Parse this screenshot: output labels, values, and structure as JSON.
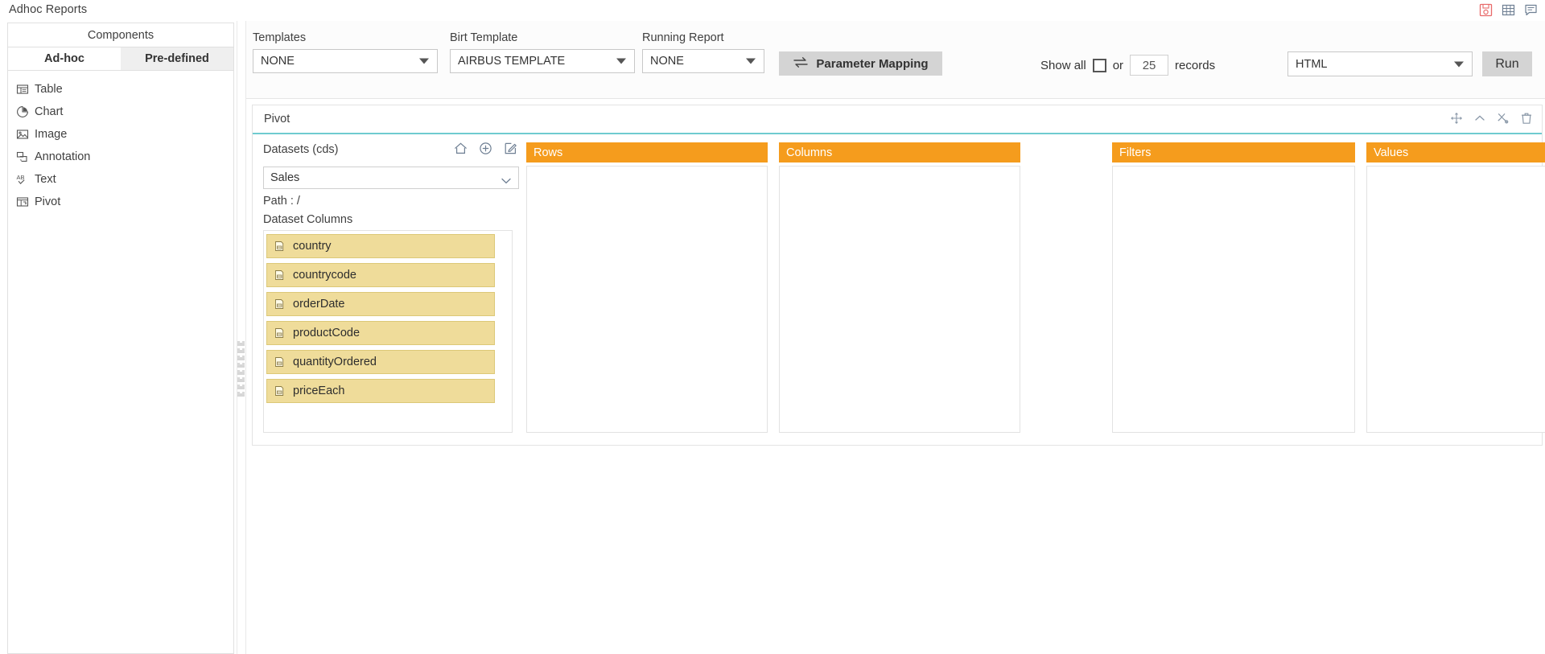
{
  "titlebar": {
    "app_title": "Adhoc Reports",
    "icons": [
      {
        "name": "save-report-icon",
        "label": "Save"
      },
      {
        "name": "grid-icon",
        "label": "Grid"
      },
      {
        "name": "comment-icon",
        "label": "Comment"
      }
    ]
  },
  "sidebar": {
    "header": "Components",
    "tabs": [
      {
        "label": "Ad-hoc",
        "active": true
      },
      {
        "label": "Pre-defined",
        "active": false
      }
    ],
    "items": [
      {
        "label": "Table",
        "icon": "table-icon"
      },
      {
        "label": "Chart",
        "icon": "pie-chart-icon"
      },
      {
        "label": "Image",
        "icon": "image-icon"
      },
      {
        "label": "Annotation",
        "icon": "annotation-icon"
      },
      {
        "label": "Text",
        "icon": "text-ab-icon"
      },
      {
        "label": "Pivot",
        "icon": "pivot-icon"
      }
    ]
  },
  "toolbar": {
    "templates": {
      "label": "Templates",
      "value": "NONE"
    },
    "birt_template": {
      "label": "Birt Template",
      "value": "AIRBUS TEMPLATE"
    },
    "running_report": {
      "label": "Running Report",
      "value": "NONE"
    },
    "parameter_mapping_label": "Parameter Mapping",
    "show_all_label": "Show all",
    "or_label": "or",
    "records_value": "25",
    "records_label": "records",
    "format": {
      "value": "HTML"
    },
    "run_label": "Run"
  },
  "pivot": {
    "title": "Pivot",
    "panel_icons": [
      {
        "name": "move-icon"
      },
      {
        "name": "collapse-chevron-up-icon"
      },
      {
        "name": "tools-icon"
      },
      {
        "name": "delete-trash-icon"
      }
    ],
    "datasets": {
      "label": "Datasets (cds)",
      "icons": [
        {
          "name": "home-icon"
        },
        {
          "name": "add-circle-icon"
        },
        {
          "name": "edit-icon"
        }
      ],
      "selected": "Sales",
      "path_label": "Path : /",
      "columns_label": "Dataset Columns",
      "columns": [
        {
          "label": "country",
          "icon": "column-field-icon"
        },
        {
          "label": "countrycode",
          "icon": "column-field-icon"
        },
        {
          "label": "orderDate",
          "icon": "column-field-icon"
        },
        {
          "label": "productCode",
          "icon": "column-field-icon"
        },
        {
          "label": "quantityOrdered",
          "icon": "column-field-icon"
        },
        {
          "label": "priceEach",
          "icon": "column-field-icon"
        }
      ]
    },
    "zones": [
      {
        "key": "rows",
        "label": "Rows",
        "items": []
      },
      {
        "key": "columns",
        "label": "Columns",
        "items": []
      },
      {
        "key": "filters",
        "label": "Filters",
        "items": []
      },
      {
        "key": "values",
        "label": "Values",
        "items": []
      }
    ]
  },
  "colors": {
    "zone_header": "#f59c1d",
    "field_chip": "#efdc9a",
    "accent_underline": "#6fcbd0",
    "button_grey": "#d4d4d4"
  }
}
